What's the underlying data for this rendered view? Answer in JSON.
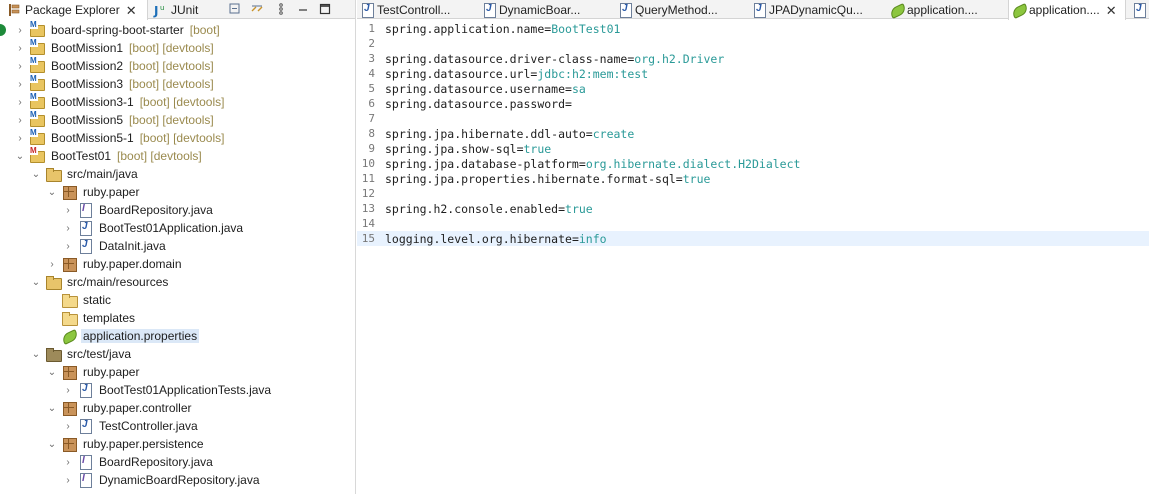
{
  "left_panel": {
    "tabs": [
      {
        "label": "Package Explorer",
        "active": true,
        "closable": true,
        "icon": "package-explorer-icon"
      },
      {
        "label": "JUnit",
        "active": false,
        "closable": false,
        "icon": "junit-icon"
      }
    ],
    "toolbar": [
      "collapse-all-icon",
      "link-with-editor-icon",
      "view-menu-icon",
      "minimize-icon",
      "maximize-icon"
    ],
    "tree": [
      {
        "name": "board-spring-boot-starter",
        "decoration": "[boot]",
        "icon": "project-icon",
        "chevron": "›"
      },
      {
        "name": "BootMission1",
        "decoration": "[boot] [devtools]",
        "icon": "project-icon",
        "chevron": "›"
      },
      {
        "name": "BootMission2",
        "decoration": "[boot] [devtools]",
        "icon": "project-icon",
        "chevron": "›"
      },
      {
        "name": "BootMission3",
        "decoration": "[boot] [devtools]",
        "icon": "project-icon",
        "chevron": "›"
      },
      {
        "name": "BootMission3-1",
        "decoration": "[boot] [devtools]",
        "icon": "project-icon",
        "chevron": "›"
      },
      {
        "name": "BootMission5",
        "decoration": "[boot] [devtools]",
        "icon": "project-icon",
        "chevron": "›"
      },
      {
        "name": "BootMission5-1",
        "decoration": "[boot] [devtools]",
        "icon": "project-icon",
        "chevron": "›"
      },
      {
        "name": "BootTest01",
        "decoration": "[boot] [devtools]",
        "icon": "project-error-icon",
        "chevron": "⌄"
      },
      {
        "name": "src/main/java",
        "decoration": "",
        "icon": "source-folder-icon",
        "chevron": "⌄"
      },
      {
        "name": "ruby.paper",
        "decoration": "",
        "icon": "package-icon",
        "chevron": "⌄"
      },
      {
        "name": "BoardRepository.java",
        "decoration": "",
        "icon": "java-interface-icon",
        "chevron": "›"
      },
      {
        "name": "BootTest01Application.java",
        "decoration": "",
        "icon": "java-file-icon",
        "chevron": "›"
      },
      {
        "name": "DataInit.java",
        "decoration": "",
        "icon": "java-file-icon",
        "chevron": "›"
      },
      {
        "name": "ruby.paper.domain",
        "decoration": "",
        "icon": "package-icon",
        "chevron": "›"
      },
      {
        "name": "src/main/resources",
        "decoration": "",
        "icon": "source-folder-icon",
        "chevron": "⌄"
      },
      {
        "name": "static",
        "decoration": "",
        "icon": "folder-icon",
        "chevron": ""
      },
      {
        "name": "templates",
        "decoration": "",
        "icon": "folder-icon",
        "chevron": ""
      },
      {
        "name": "application.properties",
        "decoration": "",
        "icon": "properties-file-icon",
        "chevron": ""
      },
      {
        "name": "src/test/java",
        "decoration": "",
        "icon": "test-source-folder-icon",
        "chevron": "⌄"
      },
      {
        "name": "ruby.paper",
        "decoration": "",
        "icon": "package-icon",
        "chevron": "⌄"
      },
      {
        "name": "BootTest01ApplicationTests.java",
        "decoration": "",
        "icon": "java-test-file-icon",
        "chevron": "›"
      },
      {
        "name": "ruby.paper.controller",
        "decoration": "",
        "icon": "package-icon",
        "chevron": "⌄"
      },
      {
        "name": "TestController.java",
        "decoration": "",
        "icon": "java-file-icon",
        "chevron": "›"
      },
      {
        "name": "ruby.paper.persistence",
        "decoration": "",
        "icon": "package-icon",
        "chevron": "⌄"
      },
      {
        "name": "BoardRepository.java",
        "decoration": "",
        "icon": "java-interface-icon",
        "chevron": "›"
      },
      {
        "name": "DynamicBoardRepository.java",
        "decoration": "",
        "icon": "java-interface-icon",
        "chevron": "›"
      }
    ]
  },
  "editor": {
    "tabs": [
      {
        "label": "TestControll...",
        "icon": "java-file-icon",
        "active": false
      },
      {
        "label": "DynamicBoar...",
        "icon": "java-file-icon",
        "active": false
      },
      {
        "label": "QueryMethod...",
        "icon": "java-file-icon",
        "active": false
      },
      {
        "label": "JPADynamicQu...",
        "icon": "java-file-icon",
        "active": false
      },
      {
        "label": "application....",
        "icon": "properties-file-icon",
        "active": false
      },
      {
        "label": "application....",
        "icon": "properties-file-icon",
        "active": true,
        "closable": true
      },
      {
        "label": "",
        "icon": "java-file-icon",
        "active": false
      }
    ],
    "lines": [
      {
        "n": "1",
        "key": "spring.application.name",
        "value": "BootTest01"
      },
      {
        "n": "2",
        "key": "",
        "value": ""
      },
      {
        "n": "3",
        "key": "spring.datasource.driver-class-name",
        "value": "org.h2.Driver"
      },
      {
        "n": "4",
        "key": "spring.datasource.url",
        "value": "jdbc:h2:mem:test"
      },
      {
        "n": "5",
        "key": "spring.datasource.username",
        "value": "sa"
      },
      {
        "n": "6",
        "key": "spring.datasource.password",
        "value": ""
      },
      {
        "n": "7",
        "key": "",
        "value": ""
      },
      {
        "n": "8",
        "key": "spring.jpa.hibernate.ddl-auto",
        "value": "create"
      },
      {
        "n": "9",
        "key": "spring.jpa.show-sql",
        "value": "true"
      },
      {
        "n": "10",
        "key": "spring.jpa.database-platform",
        "value": "org.hibernate.dialect.H2Dialect"
      },
      {
        "n": "11",
        "key": "spring.jpa.properties.hibernate.format-sql",
        "value": "true"
      },
      {
        "n": "12",
        "key": "",
        "value": ""
      },
      {
        "n": "13",
        "key": "spring.h2.console.enabled",
        "value": "true"
      },
      {
        "n": "14",
        "key": "",
        "value": ""
      },
      {
        "n": "15",
        "key": "logging.level.org.hibernate",
        "value": "info"
      }
    ],
    "current_line": "15"
  },
  "colors": {
    "value_text": "#2a9a98",
    "selection": "#dbe8f7",
    "current_line": "#e8f2fe",
    "decoration": "#9a8a4e"
  }
}
